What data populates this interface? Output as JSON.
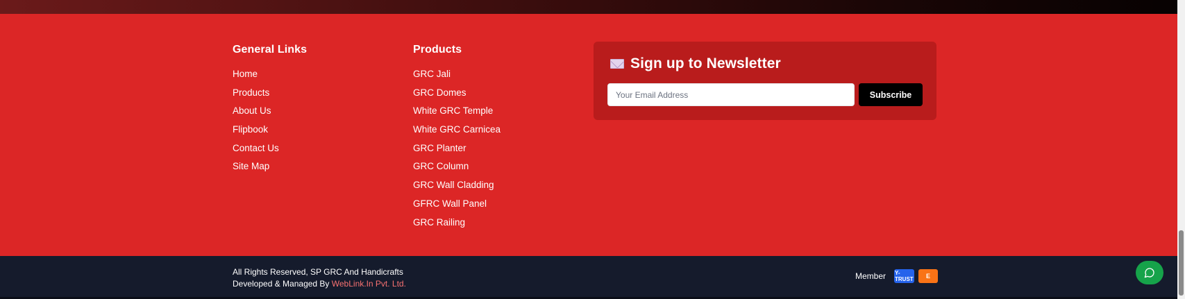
{
  "general_links": {
    "heading": "General Links",
    "items": [
      "Home",
      "Products",
      "About Us",
      "Flipbook",
      "Contact Us",
      "Site Map"
    ]
  },
  "products": {
    "heading": "Products",
    "items": [
      "GRC Jali",
      "GRC Domes",
      "White GRC Temple",
      "White GRC Carnicea",
      "GRC Planter",
      "GRC Column",
      "GRC Wall Cladding",
      "GFRC Wall Panel",
      "GRC Railing"
    ]
  },
  "newsletter": {
    "icon": "envelope-icon",
    "title": "Sign up to Newsletter",
    "email_placeholder": "Your Email Address",
    "email_value": "",
    "subscribe_label": "Subscribe"
  },
  "footer_bottom": {
    "copyright": "All Rights Reserved, SP GRC And Handicrafts",
    "developed_prefix": "Developed & Managed By ",
    "developer_link": "WebLink.In Pvt. Ltd.",
    "member_label": "Member",
    "badge_trust": "Y-TRUST",
    "badge_e": "E"
  },
  "chat_button": {
    "icon": "chat-bubble-icon"
  },
  "colors": {
    "footer_red": "#dc2626",
    "newsletter_panel": "#b91c1c",
    "bottom_bar": "#151b2c",
    "link_accent": "#f87171",
    "chat_green": "#16a34a"
  }
}
